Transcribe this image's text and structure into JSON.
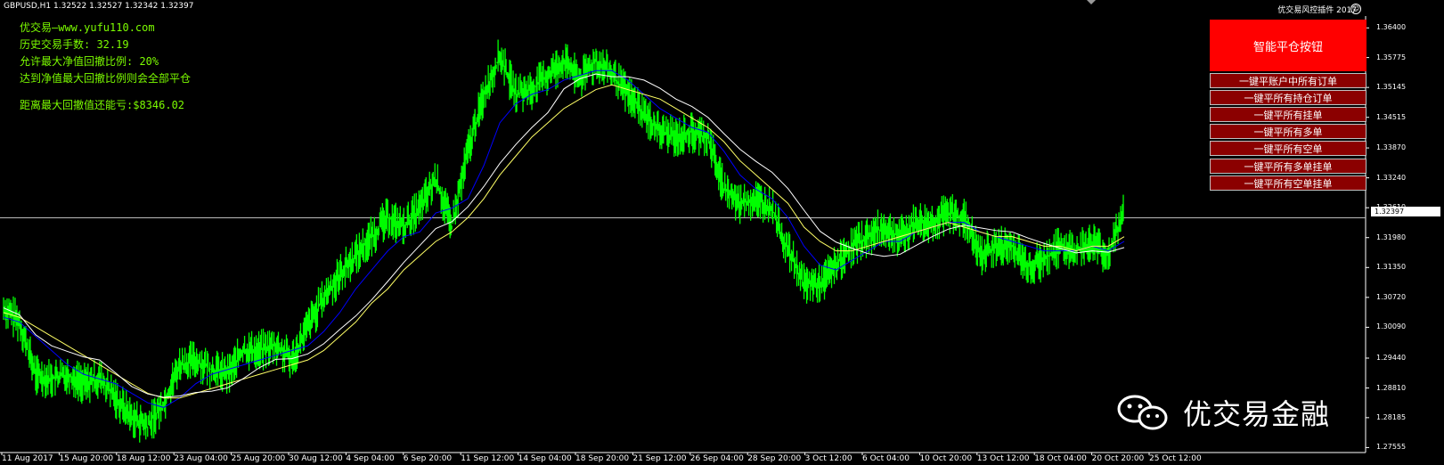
{
  "header": {
    "symbol": "GBPUSD,H1  1.32522 1.32527 1.32342 1.32397",
    "plugin_title": "优交易风控插件 2017",
    "smiley": "☺"
  },
  "info_panel": {
    "line1": "优交易—www.yufu110.com",
    "line2": "历史交易手数: 32.19",
    "line3": "允许最大净值回撤比例: 20%",
    "line4": "达到净值最大回撤比例则会全部平仓",
    "line5": "距离最大回撤值还能亏:$8346.02"
  },
  "controls": {
    "smart_close": "智能平仓按钮",
    "actions": [
      "一键平账户中所有订单",
      "一键平所有持仓订单",
      "一键平所有挂单",
      "一键平所有多单",
      "一键平所有空单",
      "一键平所有多单挂单",
      "一键平所有空单挂单"
    ]
  },
  "current_price": "1.32397",
  "watermark": "优交易金融",
  "colors": {
    "candles": "#00ff00",
    "ma_fast": "#0000ff",
    "ma_mid": "#ffff66",
    "ma_slow": "#ffffff",
    "button_main": "#ff0000",
    "button_action": "#8b0000"
  },
  "chart_data": {
    "type": "line",
    "title": "GBPUSD,H1",
    "price_axis": [
      "1.36400",
      "1.35775",
      "1.35145",
      "1.34515",
      "1.33870",
      "1.33240",
      "1.32610",
      "1.31980",
      "1.31350",
      "1.30720",
      "1.30090",
      "1.29440",
      "1.28810",
      "1.28185",
      "1.27555"
    ],
    "time_axis": [
      "11 Aug 2017",
      "15 Aug 20:00",
      "18 Aug 12:00",
      "23 Aug 04:00",
      "25 Aug 20:00",
      "30 Aug 12:00",
      "4 Sep 04:00",
      "6 Sep 20:00",
      "11 Sep 12:00",
      "14 Sep 04:00",
      "18 Sep 20:00",
      "21 Sep 12:00",
      "26 Sep 04:00",
      "28 Sep 20:00",
      "3 Oct 12:00",
      "6 Oct 04:00",
      "10 Oct 20:00",
      "13 Oct 12:00",
      "18 Oct 04:00",
      "20 Oct 20:00",
      "25 Oct 12:00"
    ],
    "ylim": [
      1.2745,
      1.3665
    ],
    "series": [
      {
        "values": [
          1.305,
          1.302,
          1.291,
          1.29,
          1.291,
          1.289,
          1.29,
          1.286,
          1.282,
          1.28,
          1.285,
          1.293,
          1.294,
          1.292,
          1.291,
          1.296,
          1.296,
          1.297,
          1.294,
          1.301,
          1.307,
          1.312,
          1.316,
          1.32,
          1.324,
          1.322,
          1.326,
          1.332,
          1.322,
          1.338,
          1.35,
          1.358,
          1.35,
          1.351,
          1.354,
          1.357,
          1.353,
          1.357,
          1.354,
          1.35,
          1.346,
          1.342,
          1.341,
          1.342,
          1.341,
          1.33,
          1.327,
          1.328,
          1.326,
          1.317,
          1.31,
          1.31,
          1.314,
          1.318,
          1.32,
          1.322,
          1.32,
          1.323,
          1.323,
          1.325,
          1.324,
          1.316,
          1.318,
          1.318,
          1.314,
          1.315,
          1.318,
          1.317,
          1.319,
          1.316,
          1.325
        ]
      },
      {
        "values": [
          1.303,
          1.302,
          1.299,
          1.296,
          1.293,
          1.291,
          1.29,
          1.289,
          1.287,
          1.285,
          1.284,
          1.286,
          1.289,
          1.291,
          1.292,
          1.293,
          1.294,
          1.295,
          1.296,
          1.297,
          1.3,
          1.304,
          1.309,
          1.313,
          1.317,
          1.32,
          1.321,
          1.325,
          1.326,
          1.328,
          1.335,
          1.344,
          1.348,
          1.35,
          1.351,
          1.353,
          1.354,
          1.355,
          1.355,
          1.353,
          1.35,
          1.347,
          1.345,
          1.343,
          1.342,
          1.338,
          1.333,
          1.33,
          1.328,
          1.324,
          1.318,
          1.314,
          1.313,
          1.315,
          1.317,
          1.319,
          1.319,
          1.321,
          1.322,
          1.323,
          1.323,
          1.321,
          1.32,
          1.319,
          1.318,
          1.317,
          1.317,
          1.317,
          1.318,
          1.317,
          1.319
        ]
      },
      {
        "values": [
          1.304,
          1.303,
          1.301,
          1.299,
          1.297,
          1.295,
          1.293,
          1.291,
          1.289,
          1.287,
          1.286,
          1.286,
          1.287,
          1.288,
          1.289,
          1.29,
          1.291,
          1.292,
          1.293,
          1.294,
          1.296,
          1.299,
          1.302,
          1.306,
          1.309,
          1.313,
          1.316,
          1.319,
          1.321,
          1.324,
          1.328,
          1.333,
          1.337,
          1.341,
          1.344,
          1.347,
          1.349,
          1.351,
          1.352,
          1.351,
          1.35,
          1.349,
          1.347,
          1.345,
          1.343,
          1.34,
          1.336,
          1.333,
          1.33,
          1.327,
          1.322,
          1.319,
          1.317,
          1.317,
          1.318,
          1.319,
          1.32,
          1.321,
          1.322,
          1.323,
          1.322,
          1.321,
          1.32,
          1.32,
          1.319,
          1.318,
          1.318,
          1.317,
          1.318,
          1.318,
          1.32
        ]
      },
      {
        "values": [
          1.305,
          1.302,
          1.291,
          1.29,
          1.291,
          1.289,
          1.29,
          1.286,
          1.282,
          1.28,
          1.285,
          1.293,
          1.294,
          1.292,
          1.291,
          1.296,
          1.296,
          1.297,
          1.294,
          1.301,
          1.307,
          1.312,
          1.316,
          1.32,
          1.324,
          1.322,
          1.326,
          1.332,
          1.322,
          1.338,
          1.35,
          1.358,
          1.35,
          1.351,
          1.354,
          1.357,
          1.353,
          1.357,
          1.354,
          1.35,
          1.346,
          1.342,
          1.341,
          1.342,
          1.341,
          1.33,
          1.327,
          1.328,
          1.326,
          1.317,
          1.31,
          1.31,
          1.314,
          1.318,
          1.32,
          1.322,
          1.32,
          1.323,
          1.323,
          1.325,
          1.324,
          1.316,
          1.318,
          1.318,
          1.314,
          1.315,
          1.318,
          1.317,
          1.319,
          1.316,
          1.325
        ]
      }
    ]
  }
}
